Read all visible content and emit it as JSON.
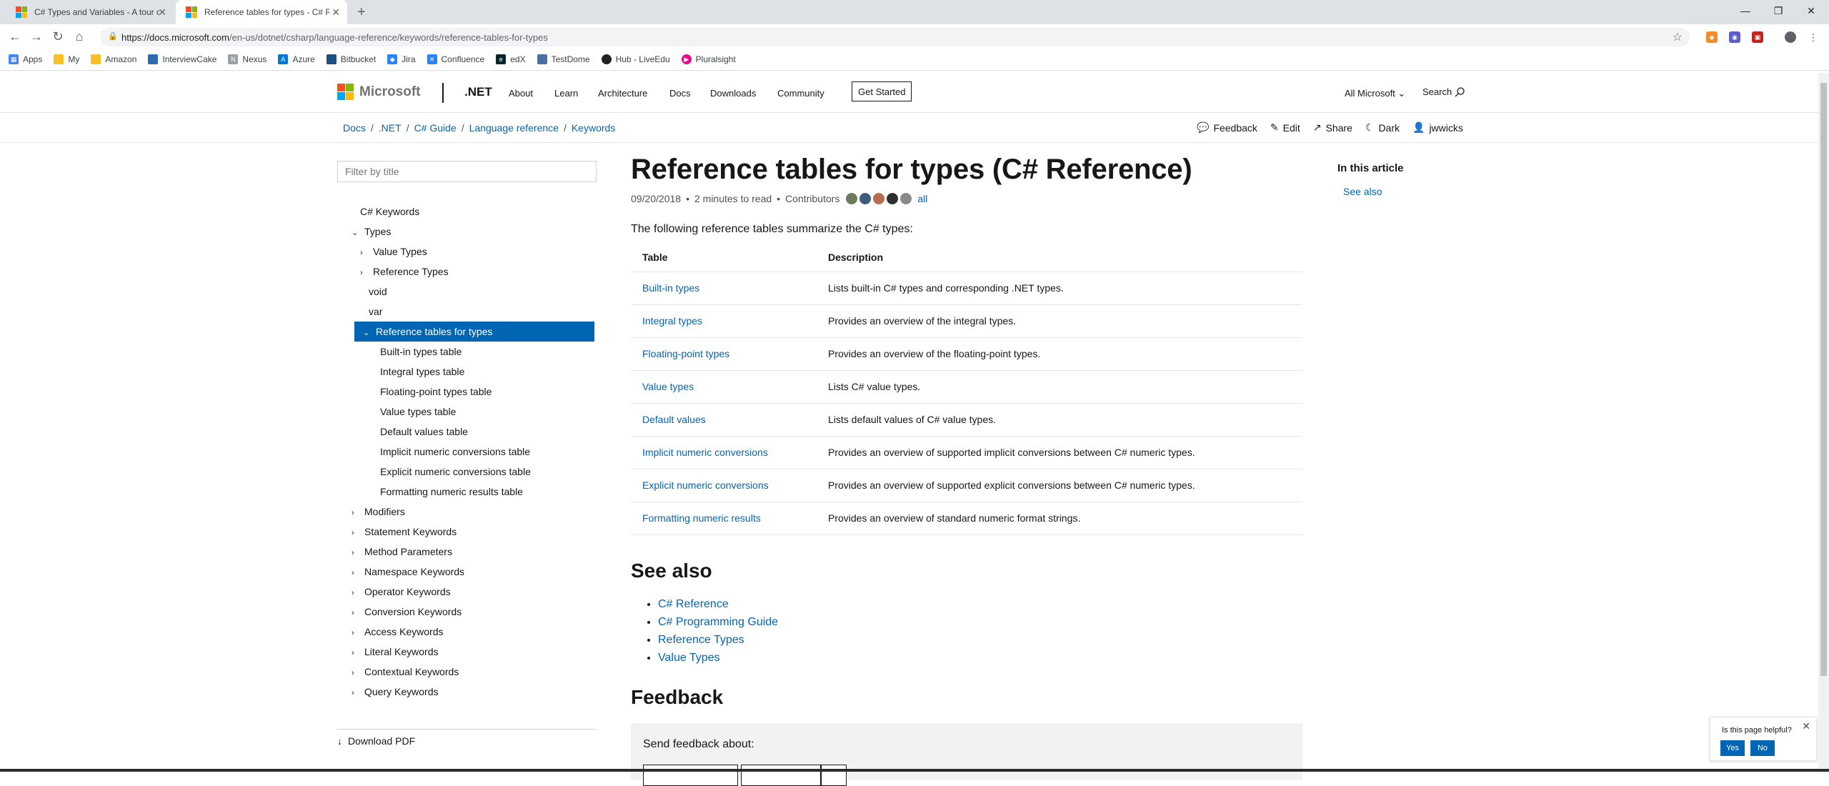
{
  "browser": {
    "tabs": [
      {
        "title": "C# Types and Variables - A tour of C#",
        "active": false
      },
      {
        "title": "Reference tables for types - C# Reference",
        "active": true
      }
    ],
    "new_tab": "+",
    "url_host": "https://docs.microsoft.com",
    "url_path": "/en-us/dotnet/csharp/language-reference/keywords/reference-tables-for-types",
    "bookmarks": [
      {
        "label": "Apps",
        "color": "#4285f4"
      },
      {
        "label": "My",
        "color": "#f6c026"
      },
      {
        "label": "Amazon",
        "color": "#f6c026"
      },
      {
        "label": "InterviewCake",
        "color": "#2b6cb0"
      },
      {
        "label": "Nexus",
        "color": "#9aa0a6"
      },
      {
        "label": "Azure",
        "color": "#0078d4"
      },
      {
        "label": "Bitbucket",
        "color": "#205081"
      },
      {
        "label": "Jira",
        "color": "#2684ff"
      },
      {
        "label": "Confluence",
        "color": "#2684ff"
      },
      {
        "label": "edX",
        "color": "#02262b"
      },
      {
        "label": "TestDome",
        "color": "#4a6fa5"
      },
      {
        "label": "Hub - LiveEdu",
        "color": "#222222"
      },
      {
        "label": "Pluralsight",
        "color": "#e80a89"
      }
    ]
  },
  "header": {
    "brand": "Microsoft",
    "product": ".NET",
    "nav": [
      "About",
      "Learn",
      "Architecture",
      "Docs",
      "Downloads",
      "Community"
    ],
    "cta": "Get Started",
    "all_microsoft": "All Microsoft",
    "search": "Search"
  },
  "breadcrumbs": [
    "Docs",
    ".NET",
    "C# Guide",
    "Language reference",
    "Keywords"
  ],
  "actions": {
    "feedback": "Feedback",
    "edit": "Edit",
    "share": "Share",
    "theme": "Dark",
    "user": "jwwicks"
  },
  "toc": {
    "filter_placeholder": "Filter by title",
    "items": [
      {
        "label": "C# Keywords",
        "level": 0,
        "chev": ""
      },
      {
        "label": "Types",
        "level": 0,
        "chev": "down"
      },
      {
        "label": "Value Types",
        "level": 1,
        "chev": "right"
      },
      {
        "label": "Reference Types",
        "level": 1,
        "chev": "right"
      },
      {
        "label": "void",
        "level": 1,
        "chev": ""
      },
      {
        "label": "var",
        "level": 1,
        "chev": ""
      },
      {
        "label": "Reference tables for types",
        "level": 1,
        "chev": "down",
        "active": true
      },
      {
        "label": "Built-in types table",
        "level": 2,
        "chev": ""
      },
      {
        "label": "Integral types table",
        "level": 2,
        "chev": ""
      },
      {
        "label": "Floating-point types table",
        "level": 2,
        "chev": ""
      },
      {
        "label": "Value types table",
        "level": 2,
        "chev": ""
      },
      {
        "label": "Default values table",
        "level": 2,
        "chev": ""
      },
      {
        "label": "Implicit numeric conversions table",
        "level": 2,
        "chev": ""
      },
      {
        "label": "Explicit numeric conversions table",
        "level": 2,
        "chev": ""
      },
      {
        "label": "Formatting numeric results table",
        "level": 2,
        "chev": ""
      },
      {
        "label": "Modifiers",
        "level": 0,
        "chev": "right"
      },
      {
        "label": "Statement Keywords",
        "level": 0,
        "chev": "right"
      },
      {
        "label": "Method Parameters",
        "level": 0,
        "chev": "right"
      },
      {
        "label": "Namespace Keywords",
        "level": 0,
        "chev": "right"
      },
      {
        "label": "Operator Keywords",
        "level": 0,
        "chev": "right"
      },
      {
        "label": "Conversion Keywords",
        "level": 0,
        "chev": "right"
      },
      {
        "label": "Access Keywords",
        "level": 0,
        "chev": "right"
      },
      {
        "label": "Literal Keywords",
        "level": 0,
        "chev": "right"
      },
      {
        "label": "Contextual Keywords",
        "level": 0,
        "chev": "right"
      },
      {
        "label": "Query Keywords",
        "level": 0,
        "chev": "right"
      }
    ],
    "download_pdf": "Download PDF"
  },
  "article": {
    "title": "Reference tables for types (C# Reference)",
    "date": "09/20/2018",
    "read_time": "2 minutes to read",
    "contributors_label": "Contributors",
    "contributors_all": "all",
    "intro": "The following reference tables summarize the C# types:",
    "table": {
      "headers": [
        "Table",
        "Description"
      ],
      "rows": [
        [
          "Built-in types",
          "Lists built-in C# types and corresponding .NET types."
        ],
        [
          "Integral types",
          "Provides an overview of the integral types."
        ],
        [
          "Floating-point types",
          "Provides an overview of the floating-point types."
        ],
        [
          "Value types",
          "Lists C# value types."
        ],
        [
          "Default values",
          "Lists default values of C# value types."
        ],
        [
          "Implicit numeric conversions",
          "Provides an overview of supported implicit conversions between C# numeric types."
        ],
        [
          "Explicit numeric conversions",
          "Provides an overview of supported explicit conversions between C# numeric types."
        ],
        [
          "Formatting numeric results",
          "Provides an overview of standard numeric format strings."
        ]
      ]
    },
    "see_also_heading": "See also",
    "see_also": [
      "C# Reference",
      "C# Programming Guide",
      "Reference Types",
      "Value Types"
    ],
    "feedback_heading": "Feedback",
    "feedback_label": "Send feedback about:"
  },
  "right_rail": {
    "title": "In this article",
    "links": [
      "See also"
    ]
  },
  "helpful": {
    "question": "Is this page helpful?",
    "yes": "Yes",
    "no": "No"
  },
  "colors": {
    "link": "#0065b3",
    "active_toc": "#0065b3",
    "ms_red": "#f25022",
    "ms_green": "#7fba00",
    "ms_blue": "#00a4ef",
    "ms_yellow": "#ffb900"
  }
}
